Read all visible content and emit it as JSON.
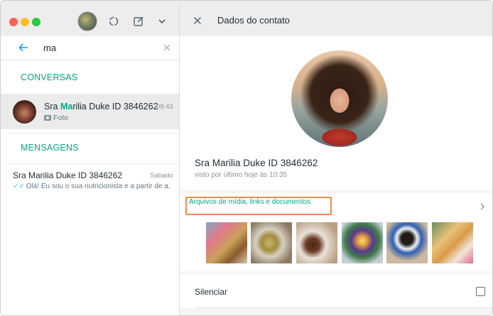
{
  "left": {
    "search": {
      "value": "ma"
    },
    "sections": {
      "conversations": "CONVERSAS",
      "messages": "MENSAGENS"
    },
    "chat": {
      "name_prefix": "Sra ",
      "name_highlight": "Ma",
      "name_suffix": "rilia Duke ID 3846262",
      "time": "09:43",
      "subtitle": "Foto",
      "subtitle_icon": "camera-icon"
    },
    "message": {
      "name": "Sra Marilia Duke ID 3846262",
      "date": "Sábado",
      "ticks": "✓✓",
      "preview": "Olá! Eu sou o sua nutricionista e a partir de a..."
    },
    "toolbar_icons": [
      "status-icon",
      "new-chat-icon",
      "chevron-down-icon"
    ]
  },
  "right": {
    "header": {
      "title": "Dados do contato",
      "close_icon": "close-icon"
    },
    "profile": {
      "name": "Sra Marilia Duke ID 3846262",
      "status": "visto por último hoje às 10:35"
    },
    "media": {
      "label": "Arquivos de mídia, links e documentos",
      "thumbnails": [
        "photo-1",
        "photo-2",
        "photo-3",
        "photo-4",
        "photo-5",
        "photo-6"
      ]
    },
    "silence": {
      "label": "Silenciar"
    }
  },
  "colors": {
    "accent": "#00a884",
    "highlight_box": "#f08a4b",
    "read_ticks": "#53bdeb",
    "header_bg": "#ededed"
  }
}
